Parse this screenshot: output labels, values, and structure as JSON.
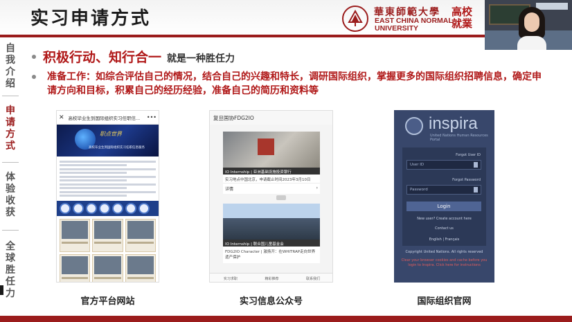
{
  "slide": {
    "title": "实习申请方式",
    "logo": {
      "name_cn": "華東師範大學",
      "name_en_line1": "EAST CHINA NORMAL",
      "name_en_line2": "UNIVERSITY",
      "calligraphy": "高校就業"
    }
  },
  "sidebar": {
    "items": [
      {
        "label": "自我介绍",
        "active": false
      },
      {
        "label": "申请方式",
        "active": true
      },
      {
        "label": "体验收获",
        "active": false
      },
      {
        "label": "全球胜任力",
        "active": false
      }
    ]
  },
  "bullets": [
    {
      "strong": "积极行动、知行合一",
      "rest": "就是一种胜任力"
    },
    {
      "text": "准备工作：如综合评估自己的情况，结合自己的兴趣和特长，调研国际组织，掌握更多的国际组织招聘信息，确定申请方向和目标，积累自己的经历经验，准备自己的简历和资料等"
    }
  ],
  "panels": [
    {
      "caption": "官方平台网站",
      "topbar_title": "高校毕业生到国际组织实习任职信...",
      "banner_heading": "职点世界",
      "banner_sub": "高校毕业生到国际组织实习任职信息服务"
    },
    {
      "caption": "实习信息公众号",
      "header": "复旦国协FDG2IO",
      "card1_caption": "IO Internship | 亚洲基础设施投资银行",
      "card1_desc": "实习地点中国北京，申请截止时间2023年3月10日",
      "card1_more": "详情",
      "card2_caption": "IO Internship | 联合国儿童基金会",
      "card2_desc": "FDG2IO Character | 激扬开：在WHITRAP走向世界遗产保护",
      "footer": [
        "实习求职",
        "精彩推荐",
        "联系我们"
      ]
    },
    {
      "caption": "国际组织官网",
      "brand": "inspira",
      "brand_sub": "United Nations Human Resources Portal",
      "forgot_id": "Forgot User ID",
      "user_placeholder": "User ID",
      "forgot_pw": "Forgot Password",
      "pw_placeholder": "Password",
      "login": "Login",
      "new_user": "New user? Create account here",
      "contact": "Contact us",
      "langs": "English | Français",
      "copyright": "Copyright United Nations. All rights reserved",
      "warning": "Clear your browser cookies and cache before you login to Inspira. Click here for instructions"
    }
  ],
  "colors": {
    "accent": "#9b1c1c",
    "bullet_red": "#b01818",
    "inspira_bg": "#38476b"
  }
}
